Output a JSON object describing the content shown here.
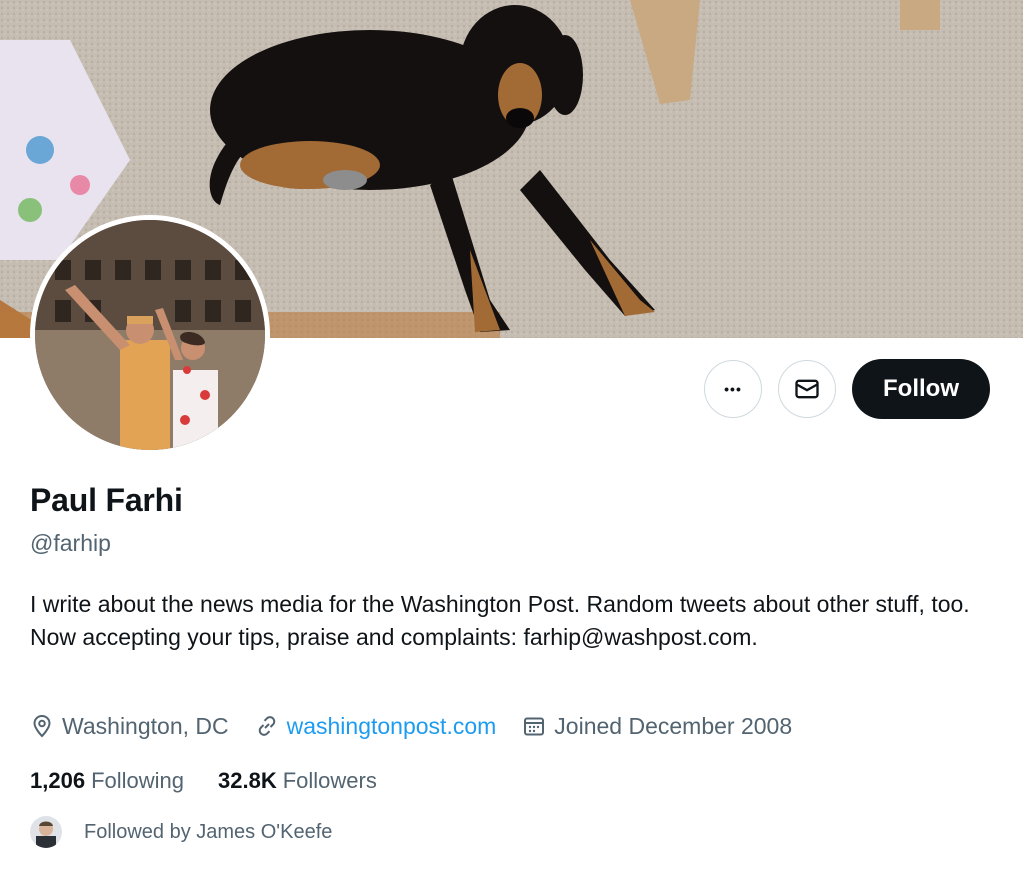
{
  "profile": {
    "name": "Paul Farhi",
    "handle": "@farhip",
    "bio": "I write about the news media for the Washington Post. Random tweets about other stuff, too. Now accepting your tips, praise and complaints: farhip@washpost.com.",
    "location": "Washington, DC",
    "website": "washingtonpost.com",
    "joined": "Joined December 2008"
  },
  "stats": {
    "following_count": "1,206",
    "following_label": "Following",
    "followers_count": "32.8K",
    "followers_label": "Followers"
  },
  "followed_by": "Followed by James O'Keefe",
  "actions": {
    "more": "•••",
    "follow_label": "Follow"
  },
  "icons": {
    "location": "location-pin-icon",
    "link": "link-icon",
    "calendar": "calendar-icon",
    "more": "more-icon",
    "message": "envelope-icon"
  },
  "colors": {
    "link": "#1d9bf0",
    "secondary_text": "#536471",
    "primary_text": "#0f1419",
    "follow_bg": "#0f1419"
  }
}
